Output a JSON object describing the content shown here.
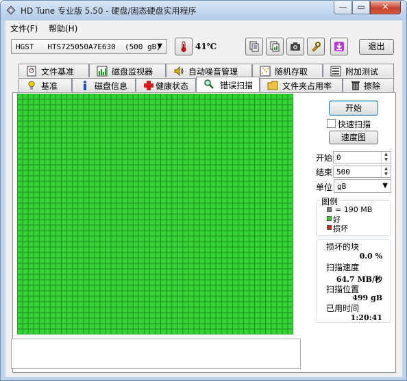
{
  "window": {
    "title": "HD Tune 专业版 5.50 - 硬盘/固态硬盘实用程序",
    "min_glyph": "—",
    "max_glyph": "▭",
    "close_glyph": "✕"
  },
  "menu": [
    {
      "label": "文件(F)"
    },
    {
      "label": "帮助(H)"
    }
  ],
  "toolbar": {
    "drive": "HGST   HTS725050A7E630  (500 gB)",
    "temperature": "41℃",
    "buttons": [
      "copy-text-icon",
      "copy-image-icon",
      "camera-icon",
      "settings-icon",
      "save-download-icon"
    ],
    "exit_label": "退出"
  },
  "tabs_top": [
    {
      "label": "文件基准",
      "icon": "file-benchmark-icon"
    },
    {
      "label": "磁盘监视器",
      "icon": "disk-monitor-icon"
    },
    {
      "label": "自动噪音管理",
      "icon": "speaker-icon"
    },
    {
      "label": "随机存取",
      "icon": "random-access-icon"
    },
    {
      "label": "附加测试",
      "icon": "extra-tests-icon"
    }
  ],
  "tabs_bottom": [
    {
      "label": "基准",
      "icon": "benchmark-icon"
    },
    {
      "label": "磁盘信息",
      "icon": "info-icon"
    },
    {
      "label": "健康状态",
      "icon": "health-cross-icon"
    },
    {
      "label": "错误扫描",
      "icon": "magnifier-icon",
      "active": true
    },
    {
      "label": "文件夹占用率",
      "icon": "folder-icon"
    },
    {
      "label": "擦除",
      "icon": "trash-icon"
    }
  ],
  "scan": {
    "start_label": "开始",
    "quick_scan_label": "快速扫描",
    "quick_scan_checked": false,
    "speed_map_label": "速度图",
    "start_field_label": "开始",
    "start_value": "0",
    "end_field_label": "结束",
    "end_value": "500",
    "unit_label": "单位",
    "unit_value": "gB",
    "grid_color": "#32d332",
    "grid_line_color": "#1f8f1f",
    "blocks_all_good": true
  },
  "legend": {
    "title": "图例",
    "block_size": "= 190 MB",
    "good_label": "好",
    "bad_label": "损坏",
    "block_color": "#808080",
    "good_color": "#32d332",
    "bad_color": "#dd2222"
  },
  "stats": {
    "damaged_label": "损坏的块",
    "damaged_value": "0.0 %",
    "speed_label": "扫描速度",
    "speed_value": "64.7 MB/秒",
    "position_label": "扫描位置",
    "position_value": "499 gB",
    "elapsed_label": "已用时间",
    "elapsed_value": "1:20:41"
  }
}
